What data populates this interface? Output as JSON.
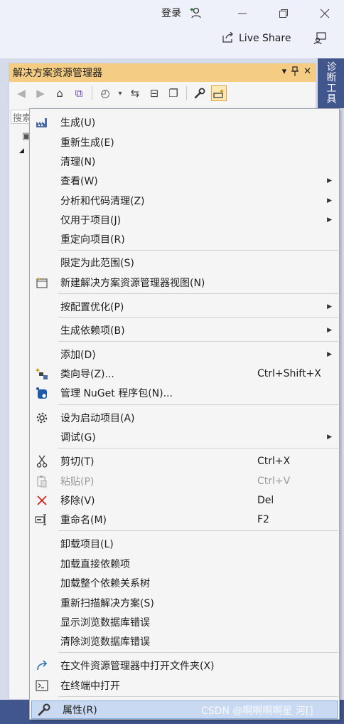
{
  "titlebar": {
    "login_label": "登录",
    "live_share_label": "Live Share"
  },
  "panel": {
    "title": "解决方案资源管理器",
    "search_placeholder": "搜索"
  },
  "side_tab_label": "诊断工具",
  "menu": {
    "items": [
      {
        "label": "生成(U)",
        "shortcut": "",
        "icon": "build-icon"
      },
      {
        "label": "重新生成(E)",
        "shortcut": ""
      },
      {
        "label": "清理(N)",
        "shortcut": ""
      },
      {
        "label": "查看(W)",
        "shortcut": "",
        "submenu": true
      },
      {
        "label": "分析和代码清理(Z)",
        "shortcut": "",
        "submenu": true
      },
      {
        "label": "仅用于项目(J)",
        "shortcut": "",
        "submenu": true
      },
      {
        "label": "重定向项目(R)",
        "shortcut": ""
      },
      {
        "label": "限定为此范围(S)",
        "shortcut": ""
      },
      {
        "label": "新建解决方案资源管理器视图(N)",
        "shortcut": "",
        "icon": "new-view-icon"
      },
      {
        "label": "按配置优化(P)",
        "shortcut": "",
        "submenu": true
      },
      {
        "label": "生成依赖项(B)",
        "shortcut": "",
        "submenu": true
      },
      {
        "label": "添加(D)",
        "shortcut": "",
        "submenu": true
      },
      {
        "label": "类向导(Z)...",
        "shortcut": "Ctrl+Shift+X",
        "icon": "class-wizard-icon"
      },
      {
        "label": "管理 NuGet 程序包(N)...",
        "shortcut": "",
        "icon": "nuget-icon"
      },
      {
        "label": "设为启动项目(A)",
        "shortcut": "",
        "icon": "gear-icon"
      },
      {
        "label": "调试(G)",
        "shortcut": "",
        "submenu": true
      },
      {
        "label": "剪切(T)",
        "shortcut": "Ctrl+X",
        "icon": "scissors-icon"
      },
      {
        "label": "粘贴(P)",
        "shortcut": "Ctrl+V",
        "icon": "paste-icon",
        "disabled": true
      },
      {
        "label": "移除(V)",
        "shortcut": "Del",
        "icon": "remove-icon"
      },
      {
        "label": "重命名(M)",
        "shortcut": "F2",
        "icon": "rename-icon"
      },
      {
        "label": "卸载项目(L)",
        "shortcut": ""
      },
      {
        "label": "加载直接依赖项",
        "shortcut": ""
      },
      {
        "label": "加载整个依赖关系树",
        "shortcut": ""
      },
      {
        "label": "重新扫描解决方案(S)",
        "shortcut": ""
      },
      {
        "label": "显示浏览数据库错误",
        "shortcut": ""
      },
      {
        "label": "清除浏览数据库错误",
        "shortcut": ""
      },
      {
        "label": "在文件资源管理器中打开文件夹(X)",
        "shortcut": "",
        "icon": "open-folder-icon"
      },
      {
        "label": "在终端中打开",
        "shortcut": "",
        "icon": "terminal-icon"
      },
      {
        "label": "属性(R)",
        "shortcut": "",
        "icon": "wrench-icon",
        "highlighted": true
      }
    ]
  },
  "watermark": "CSDN @啊啊啊啊星 河[]"
}
